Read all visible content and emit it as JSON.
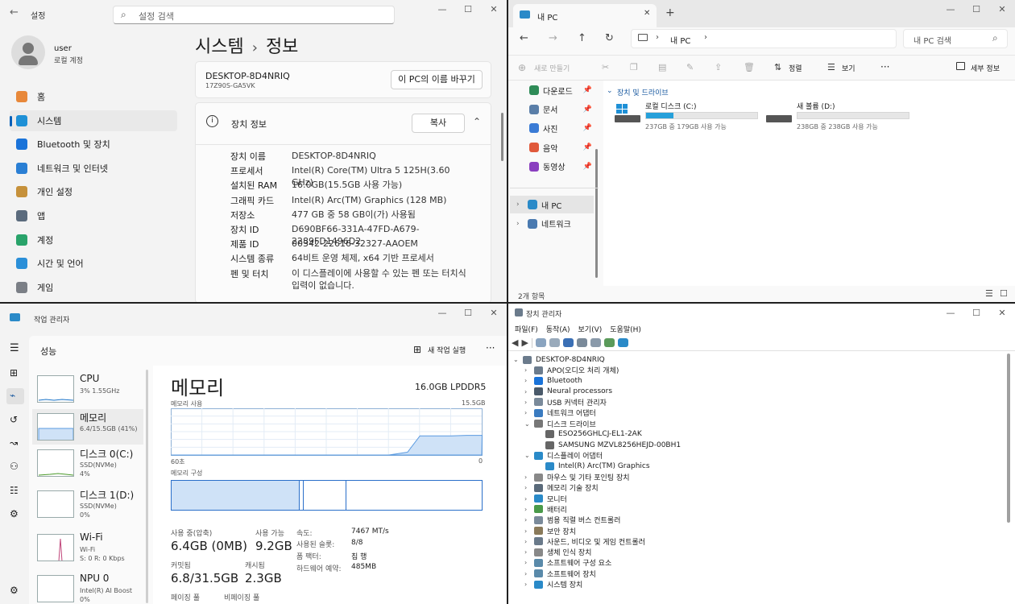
{
  "settings": {
    "title": "설정",
    "search_placeholder": "설정 검색",
    "user": {
      "name": "user",
      "account": "로컬 계정"
    },
    "sidebar": [
      {
        "label": "홈",
        "icon": "home-icon",
        "color": "#e8883a"
      },
      {
        "label": "시스템",
        "icon": "system-icon",
        "color": "#1e90d6",
        "selected": true
      },
      {
        "label": "Bluetooth 및 장치",
        "icon": "bluetooth-icon",
        "color": "#1a73d9"
      },
      {
        "label": "네트워크 및 인터넷",
        "icon": "wifi-icon",
        "color": "#2a7fd4"
      },
      {
        "label": "개인 설정",
        "icon": "brush-icon",
        "color": "#c6913b"
      },
      {
        "label": "앱",
        "icon": "apps-icon",
        "color": "#5b6b7d"
      },
      {
        "label": "계정",
        "icon": "account-icon",
        "color": "#29a36a"
      },
      {
        "label": "시간 및 언어",
        "icon": "clock-icon",
        "color": "#2b8fd8"
      },
      {
        "label": "게임",
        "icon": "gamepad-icon",
        "color": "#7b7f86"
      }
    ],
    "breadcrumb": {
      "parent": "시스템",
      "sep": "›",
      "current": "정보"
    },
    "device_name": "DESKTOP-8D4NRIQ",
    "device_model": "17Z90S-GA5VK",
    "rename_button": "이 PC의 이름 바꾸기",
    "spec_title": "장치 정보",
    "copy_button": "복사",
    "specs": [
      {
        "k": "장치 이름",
        "v": "DESKTOP-8D4NRIQ"
      },
      {
        "k": "프로세서",
        "v": "Intel(R) Core(TM) Ultra 5 125H(3.60 GHz)"
      },
      {
        "k": "설치된 RAM",
        "v": "16.0GB(15.5GB 사용 가능)"
      },
      {
        "k": "그래픽 카드",
        "v": "Intel(R) Arc(TM) Graphics (128 MB)"
      },
      {
        "k": "저장소",
        "v": "477 GB 중 58 GB이(가) 사용됨"
      },
      {
        "k": "장치 ID",
        "v": "D690BF66-331A-47FD-A679-2289FD1496D2"
      },
      {
        "k": "제품 ID",
        "v": "00342-22616-32327-AAOEM"
      },
      {
        "k": "시스템 종류",
        "v": "64비트 운영 체제, x64 기반 프로세서"
      },
      {
        "k": "펜 및 터치",
        "v": "이 디스플레이에 사용할 수 있는 펜 또는 터치식 입력이 없습니다."
      }
    ]
  },
  "explorer": {
    "tab_title": "내 PC",
    "new_tab": "+",
    "address": "내 PC",
    "search_placeholder": "내 PC 검색",
    "toolbar": {
      "new": "새로 만들기",
      "sort": "정렬",
      "view": "보기",
      "more": "···",
      "details": "세부 정보"
    },
    "nav": [
      {
        "label": "다운로드",
        "icon": "download-icon",
        "color": "#2e8b57"
      },
      {
        "label": "문서",
        "icon": "document-icon",
        "color": "#5a7ea8"
      },
      {
        "label": "사진",
        "icon": "pictures-icon",
        "color": "#3a7bd5"
      },
      {
        "label": "음악",
        "icon": "music-icon",
        "color": "#e0593b"
      },
      {
        "label": "동영상",
        "icon": "video-icon",
        "color": "#8a3fbf"
      }
    ],
    "tree": [
      {
        "label": "내 PC",
        "selected": true
      },
      {
        "label": "네트워크"
      }
    ],
    "section": "장치 및 드라이브",
    "drives": [
      {
        "name": "로컬 디스크 (C:)",
        "free": "237GB 중 179GB 사용 가능",
        "used_fraction": 0.245
      },
      {
        "name": "새 볼륨 (D:)",
        "free": "238GB 중 238GB 사용 가능",
        "used_fraction": 0.0
      }
    ],
    "status": "2개 항목"
  },
  "taskmgr": {
    "title": "작업 관리자",
    "section": "성능",
    "new_task": "새 작업 실행",
    "more": "···",
    "items": [
      {
        "name": "CPU",
        "sub1": "3% 1.55GHz",
        "sub2": ""
      },
      {
        "name": "메모리",
        "sub1": "6.4/15.5GB (41%)",
        "sub2": ""
      },
      {
        "name": "디스크 0(C:)",
        "sub1": "SSD(NVMe)",
        "sub2": "4%"
      },
      {
        "name": "디스크 1(D:)",
        "sub1": "SSD(NVMe)",
        "sub2": "0%"
      },
      {
        "name": "Wi-Fi",
        "sub1": "Wi-Fi",
        "sub2": "S: 0 R: 0 Kbps"
      },
      {
        "name": "NPU 0",
        "sub1": "Intel(R) AI Boost",
        "sub2": "0%"
      }
    ],
    "memory": {
      "title": "메모리",
      "capacity": "16.0GB LPDDR5",
      "usage_label": "메모리 사용",
      "usage_max": "15.5GB",
      "time_left": "60초",
      "time_right": "0",
      "composition_label": "메모리 구성",
      "used_fraction_history": [
        0,
        0,
        0,
        0,
        0,
        0,
        0,
        0,
        0,
        0,
        0,
        0,
        0,
        0,
        0,
        0.06,
        0.41,
        0.41,
        0.41,
        0.42,
        0.42
      ],
      "stats": {
        "in_use_label": "사용 중(압축)",
        "in_use": "6.4GB (0MB)",
        "available_label": "사용 가능",
        "available": "9.2GB",
        "committed_label": "커밋됨",
        "committed": "6.8/31.5GB",
        "cached_label": "캐시됨",
        "cached": "2.3GB",
        "paged_label": "페이징 풀",
        "nonpaged_label": "비페이징 풀",
        "speed_label": "속도:",
        "speed": "7467 MT/s",
        "slots_label": "사용된 슬롯:",
        "slots": "8/8",
        "form_label": "폼 팩터:",
        "form": "칩 행",
        "reserved_label": "하드웨어 예약:",
        "reserved": "485MB"
      }
    }
  },
  "devmgr": {
    "title": "장치 관리자",
    "menu": [
      "파일(F)",
      "동작(A)",
      "보기(V)",
      "도움말(H)"
    ],
    "root": "DESKTOP-8D4NRIQ",
    "nodes": [
      {
        "label": "APO(오디오 처리 개체)",
        "level": 1,
        "exp": "›",
        "color": "#6b7b8c"
      },
      {
        "label": "Bluetooth",
        "level": 1,
        "exp": "›",
        "color": "#1a73d9"
      },
      {
        "label": "Neural processors",
        "level": 1,
        "exp": "›",
        "color": "#4a5a6a"
      },
      {
        "label": "USB 커넥터 관리자",
        "level": 1,
        "exp": "›",
        "color": "#7a8a9a"
      },
      {
        "label": "네트워크 어댑터",
        "level": 1,
        "exp": "›",
        "color": "#3a7bc0"
      },
      {
        "label": "디스크 드라이브",
        "level": 1,
        "exp": "⌄",
        "color": "#777"
      },
      {
        "label": "ESO256GHLCJ-EL1-2AK",
        "level": 2,
        "exp": "",
        "color": "#666"
      },
      {
        "label": "SAMSUNG MZVL8256HEJD-00BH1",
        "level": 2,
        "exp": "",
        "color": "#666"
      },
      {
        "label": "디스플레이 어댑터",
        "level": 1,
        "exp": "⌄",
        "color": "#2a8ac8"
      },
      {
        "label": "Intel(R) Arc(TM) Graphics",
        "level": 2,
        "exp": "",
        "color": "#2a8ac8"
      },
      {
        "label": "마우스 및 기타 포인팅 장치",
        "level": 1,
        "exp": "›",
        "color": "#888"
      },
      {
        "label": "메모리 기술 장치",
        "level": 1,
        "exp": "›",
        "color": "#5a6a7a"
      },
      {
        "label": "모니터",
        "level": 1,
        "exp": "›",
        "color": "#2a8ac8"
      },
      {
        "label": "배터리",
        "level": 1,
        "exp": "›",
        "color": "#4a9a4a"
      },
      {
        "label": "범용 직렬 버스 컨트롤러",
        "level": 1,
        "exp": "›",
        "color": "#7a8a9a"
      },
      {
        "label": "보안 장치",
        "level": 1,
        "exp": "›",
        "color": "#8a7a5a"
      },
      {
        "label": "사운드, 비디오 및 게임 컨트롤러",
        "level": 1,
        "exp": "›",
        "color": "#6a7a8a"
      },
      {
        "label": "생체 인식 장치",
        "level": 1,
        "exp": "›",
        "color": "#888"
      },
      {
        "label": "소프트웨어 구성 요소",
        "level": 1,
        "exp": "›",
        "color": "#5a8aaa"
      },
      {
        "label": "소프트웨어 장치",
        "level": 1,
        "exp": "›",
        "color": "#5a8aaa"
      },
      {
        "label": "시스템 장치",
        "level": 1,
        "exp": "›",
        "color": "#2a8ac8"
      }
    ]
  }
}
